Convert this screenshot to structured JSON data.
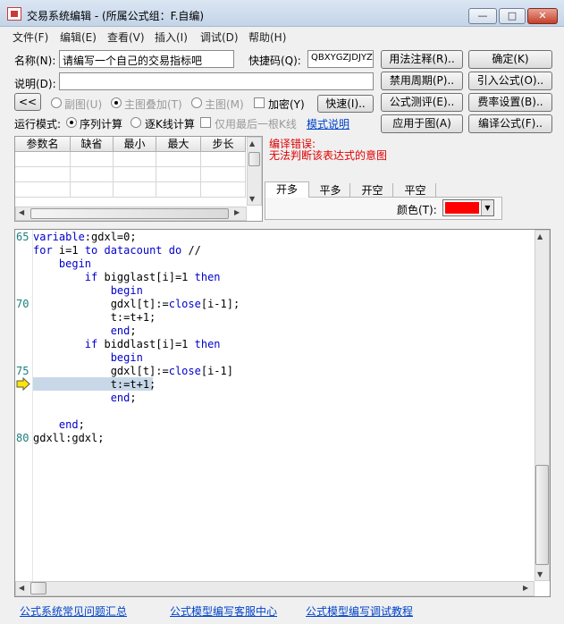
{
  "window": {
    "title": "交易系统编辑 - (所属公式组：F.自编)",
    "minimize": "—",
    "maximize": "□",
    "close": "✕"
  },
  "menu": [
    "文件(F)",
    "编辑(E)",
    "查看(V)",
    "插入(I)",
    "调试(D)",
    "帮助(H)"
  ],
  "form": {
    "name_label": "名称(N):",
    "name_value": "请编写一个自己的交易指标吧",
    "shortcut_label": "快捷码(Q):",
    "shortcut_value": "QBXYGZJDJYZB",
    "desc_label": "说明(D):",
    "desc_value": "",
    "collapse_btn": "<<",
    "radio_subchart": "副图(U)",
    "radio_overlay": "主图叠加(T)",
    "radio_main": "主图(M)",
    "encrypt": "加密(Y)",
    "fast_btn": "快速(I)..",
    "run_mode_label": "运行模式:",
    "mode_sequence": "序列计算",
    "mode_bar": "逐K线计算",
    "last_bar_only": "仅用最后一根K线",
    "mode_help_link": "模式说明"
  },
  "buttons": {
    "usage_notes": "用法注释(R)..",
    "confirm": "确定(K)",
    "disable_period": "禁用周期(P)..",
    "import_formula": "引入公式(O)..",
    "formula_test": "公式测评(E)..",
    "fee_settings": "费率设置(B)..",
    "apply_to_chart": "应用于图(A)",
    "compile": "编译公式(F).."
  },
  "param_table": {
    "headers": [
      "参数名",
      "缺省",
      "最小",
      "最大",
      "步长"
    ]
  },
  "compile": {
    "error_title": "编译错误:",
    "error_message": "无法判断该表达式的意图"
  },
  "signal_tabs": [
    "开多",
    "平多",
    "开空",
    "平空"
  ],
  "color_label": "颜色(T):",
  "color_value": "#ff0000",
  "code": {
    "lines": [
      {
        "num": "65",
        "text": "variable:gdxl=0;"
      },
      {
        "num": "",
        "text": "for i=1 to datacount do //"
      },
      {
        "num": "",
        "text": "    begin"
      },
      {
        "num": "",
        "text": "        if bigglast[i]=1 then"
      },
      {
        "num": "",
        "text": "            begin"
      },
      {
        "num": "70",
        "text": "            gdxl[t]:=close[i-1];"
      },
      {
        "num": "",
        "text": "            t:=t+1;"
      },
      {
        "num": "",
        "text": "            end;"
      },
      {
        "num": "",
        "text": "        if biddlast[i]=1 then"
      },
      {
        "num": "",
        "text": "            begin"
      },
      {
        "num": "75",
        "text": "            gdxl[t]:=close[i-1]"
      },
      {
        "num": "",
        "text": "            t:=t+1;"
      },
      {
        "num": "",
        "text": "            end;"
      },
      {
        "num": "",
        "text": ""
      },
      {
        "num": "",
        "text": "    end;"
      },
      {
        "num": "80",
        "text": "gdxll:gdxl;"
      }
    ],
    "error_line_index": 11
  },
  "footer_links": [
    "公式系统常见问题汇总",
    "公式模型编写客服中心",
    "公式模型编写调试教程"
  ]
}
